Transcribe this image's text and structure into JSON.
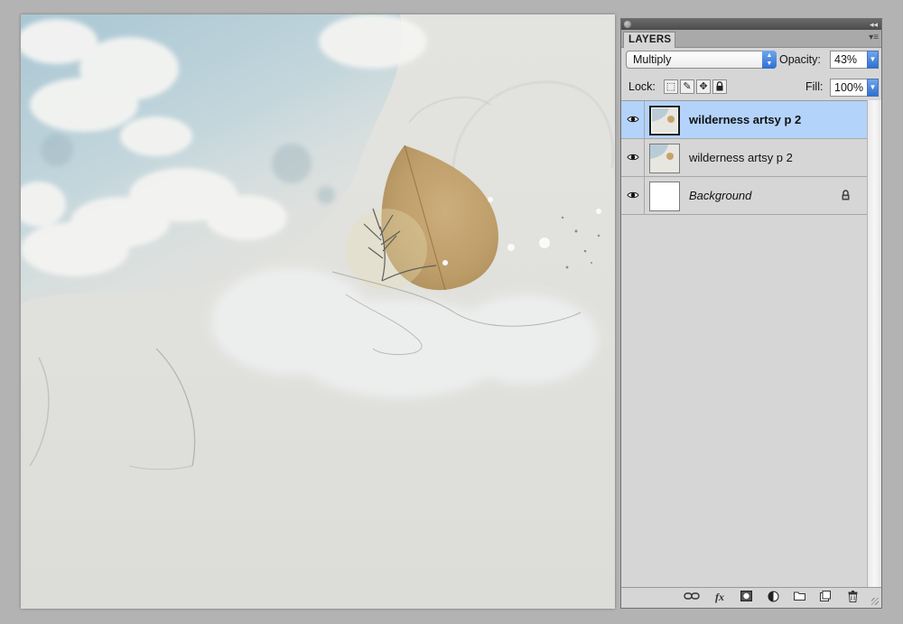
{
  "layers_panel": {
    "tab_label": "LAYERS",
    "blend_mode": "Multiply",
    "opacity_label": "Opacity:",
    "opacity_value": "43%",
    "lock_label": "Lock:",
    "fill_label": "Fill:",
    "fill_value": "100%",
    "layers": [
      {
        "name": "wilderness artsy p 2",
        "visible": true,
        "selected": true,
        "locked": false
      },
      {
        "name": "wilderness artsy p 2",
        "visible": true,
        "selected": false,
        "locked": false
      },
      {
        "name": "Background",
        "visible": true,
        "selected": false,
        "locked": true
      }
    ],
    "bottom_icons": [
      "link-layers-icon",
      "fx-icon",
      "layer-mask-icon",
      "adjustment-layer-icon",
      "new-group-icon",
      "new-layer-icon",
      "trash-icon"
    ],
    "fx_glyph": "fx"
  },
  "colors": {
    "selection_blue": "#b4d3fb",
    "panel_bg": "#d6d6d6",
    "workspace_bg": "#b3b3b3",
    "accent_blue": "#2f6fd1"
  }
}
